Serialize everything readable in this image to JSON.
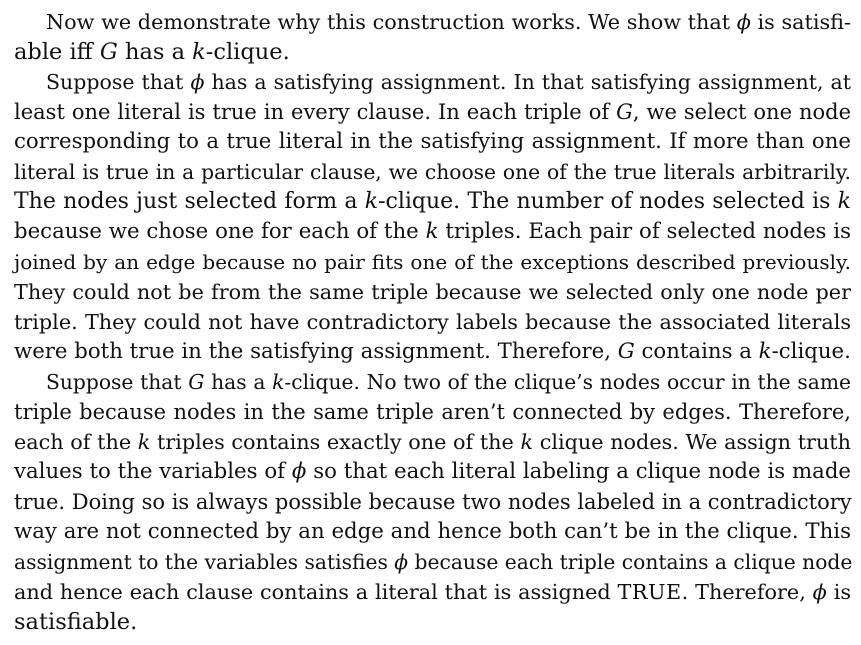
{
  "lines": [
    "Now we demonstrate why this construction works. We show that ϕ is satisfi-",
    "able iff G has a k-clique.",
    "Suppose that ϕ has a satisfying assignment. In that satisfying assignment, at",
    "least one literal is true in every clause. In each triple of G, we select one node",
    "corresponding to a true literal in the satisfying assignment. If more than one",
    "literal is true in a particular clause, we choose one of the true literals arbitrarily.",
    "The nodes just selected form a k-clique. The number of nodes selected is k",
    "because we chose one for each of the k triples. Each pair of selected nodes is",
    "joined by an edge because no pair fits one of the exceptions described previously.",
    "They could not be from the same triple because we selected only one node per",
    "triple. They could not have contradictory labels because the associated literals",
    "were both true in the satisfying assignment. Therefore, G contains a k-clique.",
    "Suppose that G has a k-clique. No two of the clique’s nodes occur in the same",
    "triple because nodes in the same triple aren’t connected by edges. Therefore,",
    "each of the k triples contains exactly one of the k clique nodes. We assign truth",
    "values to the variables of ϕ so that each literal labeling a clique node is made",
    "true. Doing so is always possible because two nodes labeled in a contradictory",
    "way are not connected by an edge and hence both can’t be in the clique. This",
    "assignment to the variables satisfies ϕ because each triple contains a clique node",
    "and hence each clause contains a literal that is assigned TRUE. Therefore, ϕ is",
    "satisfiable."
  ],
  "lines_meta": [
    {
      "justify": true,
      "indent": true
    },
    {
      "justify": false,
      "indent": false
    },
    {
      "justify": true,
      "indent": true
    },
    {
      "justify": true,
      "indent": false
    },
    {
      "justify": true,
      "indent": false
    },
    {
      "justify": true,
      "indent": false
    },
    {
      "justify": true,
      "indent": false
    },
    {
      "justify": true,
      "indent": false
    },
    {
      "justify": true,
      "indent": false
    },
    {
      "justify": true,
      "indent": false
    },
    {
      "justify": true,
      "indent": false
    },
    {
      "justify": false,
      "indent": false
    },
    {
      "justify": true,
      "indent": true
    },
    {
      "justify": true,
      "indent": false
    },
    {
      "justify": true,
      "indent": false
    },
    {
      "justify": true,
      "indent": false
    },
    {
      "justify": true,
      "indent": false
    },
    {
      "justify": true,
      "indent": false
    },
    {
      "justify": true,
      "indent": false
    },
    {
      "justify": true,
      "indent": false
    },
    {
      "justify": false,
      "indent": false
    }
  ]
}
